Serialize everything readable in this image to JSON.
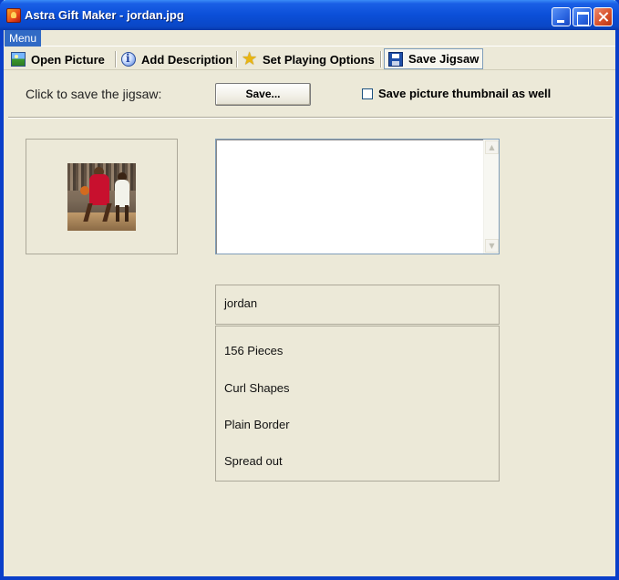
{
  "window": {
    "title": "Astra Gift Maker - jordan.jpg"
  },
  "menu": {
    "label": "Menu"
  },
  "tabs": [
    {
      "label": "Open Picture",
      "icon": "picture-icon"
    },
    {
      "label": "Add Description",
      "icon": "info-icon"
    },
    {
      "label": "Set Playing Options",
      "icon": "star-icon"
    },
    {
      "label": "Save Jigsaw",
      "icon": "floppy-disk-icon",
      "active": true
    }
  ],
  "save_panel": {
    "prompt": "Click to save the jigsaw:",
    "save_button": "Save...",
    "thumbnail_checkbox": {
      "label": "Save picture thumbnail as well",
      "checked": false
    }
  },
  "description": {
    "value": ""
  },
  "summary": {
    "title": "jordan",
    "lines": [
      "156 Pieces",
      "Curl Shapes",
      "Plain Border",
      "Spread out"
    ]
  }
}
